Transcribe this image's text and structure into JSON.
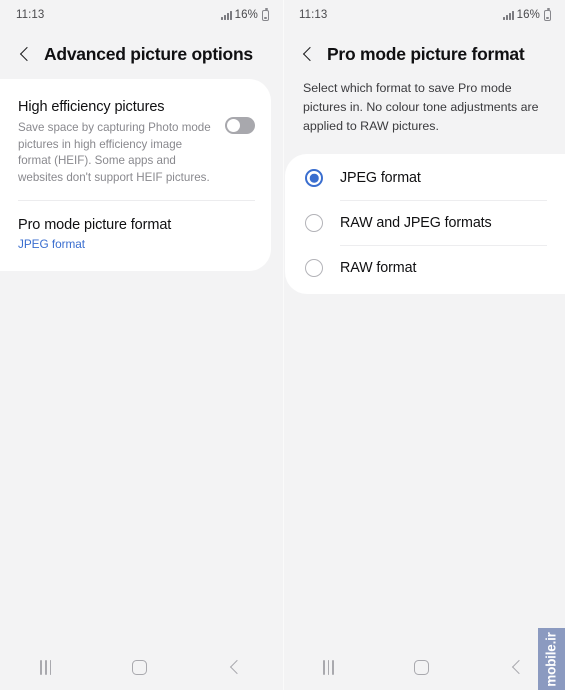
{
  "status_bar": {
    "time": "11:13",
    "battery_percent": "16%",
    "signal_icon": "signal-bars-icon",
    "battery_icon": "battery-icon"
  },
  "left_screen": {
    "back_icon": "back-chevron-icon",
    "title": "Advanced picture options",
    "high_efficiency": {
      "title": "High efficiency pictures",
      "subtitle": "Save space by capturing Photo mode pictures in high efficiency image format (HEIF). Some apps and websites don't support HEIF pictures.",
      "toggle_state": "off"
    },
    "pro_mode": {
      "title": "Pro mode picture format",
      "value": "JPEG format",
      "value_color": "#3a6ecf"
    }
  },
  "right_screen": {
    "back_icon": "back-chevron-icon",
    "title": "Pro mode picture format",
    "description": "Select which format to save Pro mode pictures in. No colour tone adjustments are applied to RAW pictures.",
    "options": [
      {
        "label": "JPEG format",
        "selected": true
      },
      {
        "label": "RAW and JPEG formats",
        "selected": false
      },
      {
        "label": "RAW format",
        "selected": false
      }
    ],
    "accent_color": "#3a6ecf"
  },
  "nav_bar": {
    "recents_icon": "recents-icon",
    "home_icon": "home-icon",
    "back_icon": "nav-back-icon"
  },
  "watermark": {
    "text": "mobile.ir",
    "background": "#8b9ac0"
  }
}
